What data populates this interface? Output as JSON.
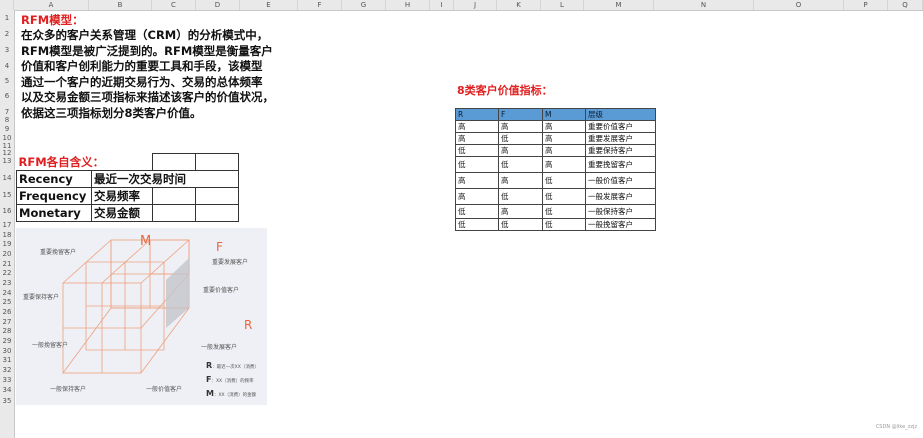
{
  "columns": [
    "A",
    "B",
    "C",
    "D",
    "E",
    "F",
    "G",
    "H",
    "I",
    "J",
    "K",
    "L",
    "M",
    "N",
    "O",
    "P",
    "Q"
  ],
  "rows": [
    "1",
    "2",
    "3",
    "4",
    "5",
    "6",
    "7",
    "8",
    "9",
    "10",
    "11",
    "12",
    "13",
    "14",
    "15",
    "16",
    "17",
    "18",
    "19",
    "20",
    "21",
    "22",
    "23",
    "24",
    "25",
    "26",
    "27",
    "28",
    "29",
    "30",
    "31",
    "32",
    "33",
    "34",
    "35"
  ],
  "rfm_title": "RFM模型：",
  "paragraph": [
    "在众多的客户关系管理（CRM）的分析模式中，",
    "RFM模型是被广泛提到的。RFM模型是衡量客户",
    "价值和客户创利能力的重要工具和手段，该模型",
    "通过一个客户的近期交易行为、交易的总体频率",
    "以及交易金额三项指标来描述该客户的价值状况，",
    "依据这三项指标划分8类客户价值。"
  ],
  "definitions": {
    "title": "RFM各自含义：",
    "rows": [
      {
        "term": "Recency",
        "meaning": "最近一次交易时间"
      },
      {
        "term": "Frequency",
        "meaning": "交易频率"
      },
      {
        "term": "Monetary",
        "meaning": "交易金额"
      }
    ]
  },
  "value_table": {
    "title": "8类客户价值指标：",
    "headers": [
      "R",
      "F",
      "M",
      "层级"
    ],
    "rows": [
      [
        "高",
        "高",
        "高",
        "重要价值客户"
      ],
      [
        "高",
        "低",
        "高",
        "重要发展客户"
      ],
      [
        "低",
        "高",
        "高",
        "重要保持客户"
      ],
      [
        "低",
        "低",
        "高",
        "重要挽留客户"
      ],
      [
        "高",
        "高",
        "低",
        "一般价值客户"
      ],
      [
        "高",
        "低",
        "低",
        "一般发展客户"
      ],
      [
        "低",
        "高",
        "低",
        "一般保持客户"
      ],
      [
        "低",
        "低",
        "低",
        "一般挽留客户"
      ]
    ]
  },
  "cube": {
    "axis_m": "M",
    "axis_f": "F",
    "axis_r": "R",
    "labels": {
      "important_retain": "重要挽留客户",
      "important_develop": "重要发展客户",
      "important_keep": "重要保持客户",
      "important_value": "重要价值客户",
      "general_retain": "一般挽留客户",
      "general_develop": "一般发展客户",
      "general_keep": "一般保持客户",
      "general_value": "一般价值客户"
    },
    "legend": [
      {
        "key": "R",
        "desc": "：最近一次XX（消费）"
      },
      {
        "key": "F",
        "desc": "：XX（消费）的频率"
      },
      {
        "key": "M",
        "desc": "：XX（消费）的金额"
      }
    ],
    "accent_color": "#e8673c"
  },
  "watermark": "CSDN @like_zzjz"
}
